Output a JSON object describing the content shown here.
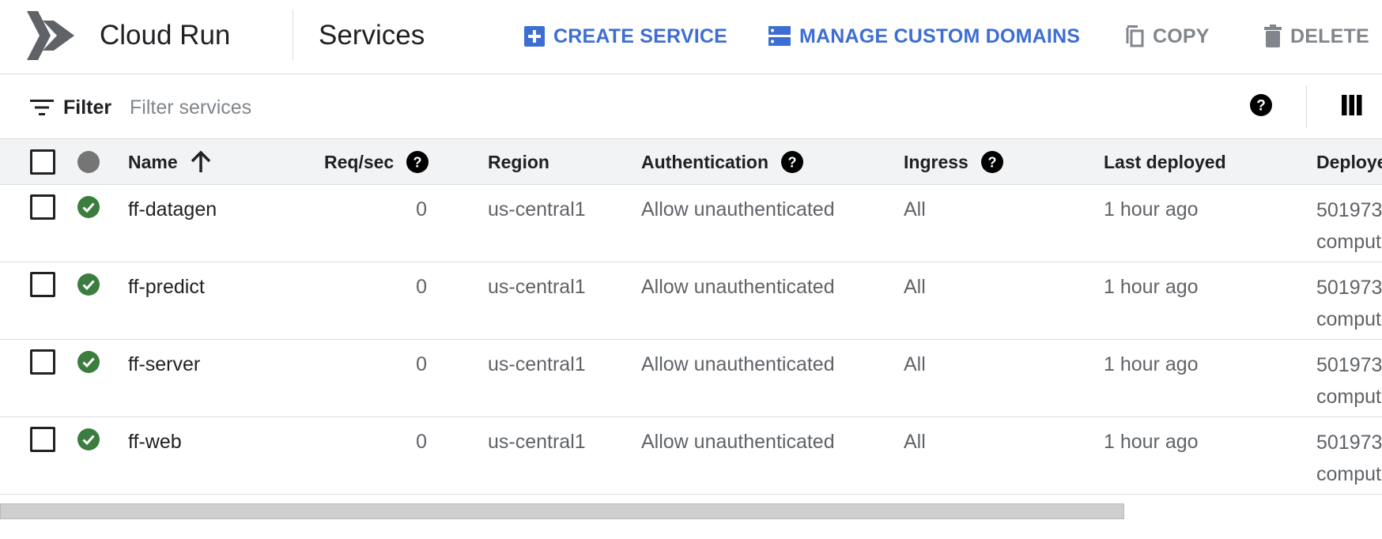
{
  "header": {
    "product_name": "Cloud Run",
    "page_title": "Services",
    "actions": [
      {
        "label": "CREATE SERVICE",
        "icon": "add-box-icon",
        "color": "#3d6ed3"
      },
      {
        "label": "MANAGE CUSTOM DOMAINS",
        "icon": "domain-list-icon",
        "color": "#3d6ed3"
      },
      {
        "label": "COPY",
        "icon": "copy-icon",
        "color": "#80868b"
      },
      {
        "label": "DELETE",
        "icon": "trash-icon",
        "color": "#80868b"
      }
    ]
  },
  "filter": {
    "label": "Filter",
    "placeholder": "Filter services"
  },
  "table": {
    "columns": {
      "name": "Name",
      "req_sec": "Req/sec",
      "region": "Region",
      "authentication": "Authentication",
      "ingress": "Ingress",
      "last_deployed": "Last deployed",
      "deployed_by": "Deploye"
    },
    "sort": {
      "column": "Name",
      "direction": "ascending"
    },
    "rows": [
      {
        "name": "ff-datagen",
        "req_sec": "0",
        "region": "us-central1",
        "authentication": "Allow unauthenticated",
        "ingress": "All",
        "last_deployed": "1 hour ago",
        "deployed_by_line1": "501973",
        "deployed_by_line2": "comput",
        "status": "ok"
      },
      {
        "name": "ff-predict",
        "req_sec": "0",
        "region": "us-central1",
        "authentication": "Allow unauthenticated",
        "ingress": "All",
        "last_deployed": "1 hour ago",
        "deployed_by_line1": "501973",
        "deployed_by_line2": "comput",
        "status": "ok"
      },
      {
        "name": "ff-server",
        "req_sec": "0",
        "region": "us-central1",
        "authentication": "Allow unauthenticated",
        "ingress": "All",
        "last_deployed": "1 hour ago",
        "deployed_by_line1": "501973",
        "deployed_by_line2": "comput",
        "status": "ok"
      },
      {
        "name": "ff-web",
        "req_sec": "0",
        "region": "us-central1",
        "authentication": "Allow unauthenticated",
        "ingress": "All",
        "last_deployed": "1 hour ago",
        "deployed_by_line1": "501973",
        "deployed_by_line2": "comput",
        "status": "ok"
      }
    ]
  },
  "colors": {
    "accent": "#3d6ed3",
    "status_ok": "#3b7d3f",
    "header_bg": "#f1f3f4"
  }
}
